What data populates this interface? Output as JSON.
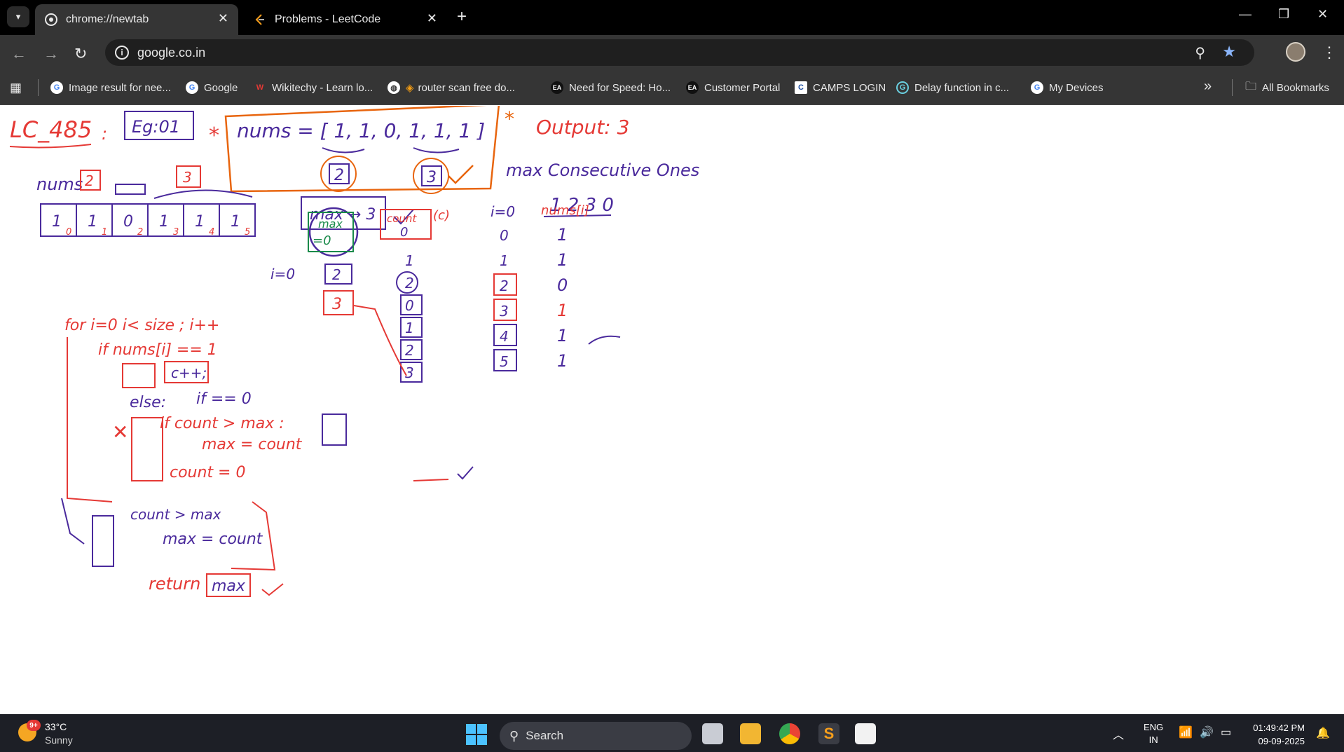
{
  "tabs": [
    {
      "title": "chrome://newtab",
      "active": true
    },
    {
      "title": "Problems - LeetCode",
      "active": false
    }
  ],
  "toolbar": {
    "url": "google.co.in"
  },
  "bookmarks": [
    {
      "label": "Image result for nee...",
      "icon": "google-icon"
    },
    {
      "label": "Google",
      "icon": "google-icon"
    },
    {
      "label": "Wikitechy - Learn lo...",
      "icon": "wikitechy-icon"
    },
    {
      "label": "router scan free do...",
      "icon": "globe-icon"
    },
    {
      "label": "Need for Speed: Ho...",
      "icon": "ea-icon"
    },
    {
      "label": "Customer Portal",
      "icon": "ea-icon"
    },
    {
      "label": "CAMPS LOGIN",
      "icon": "camps-icon"
    },
    {
      "label": "Delay function in c...",
      "icon": "delay-icon"
    },
    {
      "label": "My Devices",
      "icon": "google-icon"
    }
  ],
  "all_bookmarks_label": "All Bookmarks",
  "whiteboard": {
    "title": "LC_485",
    "example_tag": "Eg:01",
    "nums_expr": "nums = [ 1, 1, 0, 1, 1, 1 ]",
    "group_counts": [
      "2",
      "3"
    ],
    "output": "Output: 3",
    "description": "max Consecutive Ones",
    "max_result": "max → 3",
    "digits": "1 2 3 0",
    "array_label": "nums",
    "array_counts": [
      "2",
      "3"
    ],
    "array_values": [
      "1",
      "1",
      "0",
      "1",
      "1",
      "1"
    ],
    "array_indices": [
      "0",
      "1",
      "2",
      "3",
      "4",
      "5"
    ],
    "loop_header": "for i=0 i< size ; i++",
    "if_line": "if nums[i] == 1",
    "increment": "c++;",
    "else_label": "else:",
    "else_if": "if == 0",
    "cond_line": "if count > max :",
    "assign_line": "max = count",
    "reset_line": "count = 0",
    "post_cond": "count > max",
    "post_assign": "max = count",
    "return_label": "return",
    "return_value": "max",
    "i_start": "i=0",
    "max_box": "max",
    "max_init": "=0",
    "max_steps": [
      "2",
      "3"
    ],
    "count_box": "count",
    "count_c": "(c)",
    "count_init": "0",
    "count_steps": [
      "1",
      "2",
      "0",
      "1",
      "2",
      "3"
    ],
    "table_header_i": "i=0",
    "table_header_nums": "nums[i]",
    "table_i": [
      "0",
      "1",
      "2",
      "3",
      "4",
      "5"
    ],
    "table_nums": [
      "1",
      "1",
      "0",
      "1",
      "1",
      "1"
    ]
  },
  "taskbar": {
    "weather_badge": "9+",
    "temperature": "33°C",
    "condition": "Sunny",
    "search_label": "Search",
    "lang_top": "ENG",
    "lang_bottom": "IN",
    "time": "01:49:42 PM",
    "date": "09-09-2025"
  },
  "colors": {
    "red_ink": "#e53935",
    "purple_ink": "#4a2a9c",
    "orange_ink": "#e8650e",
    "green_ink": "#1a8a4a",
    "chrome_dark": "#353535",
    "taskbar": "#1d1f26"
  }
}
